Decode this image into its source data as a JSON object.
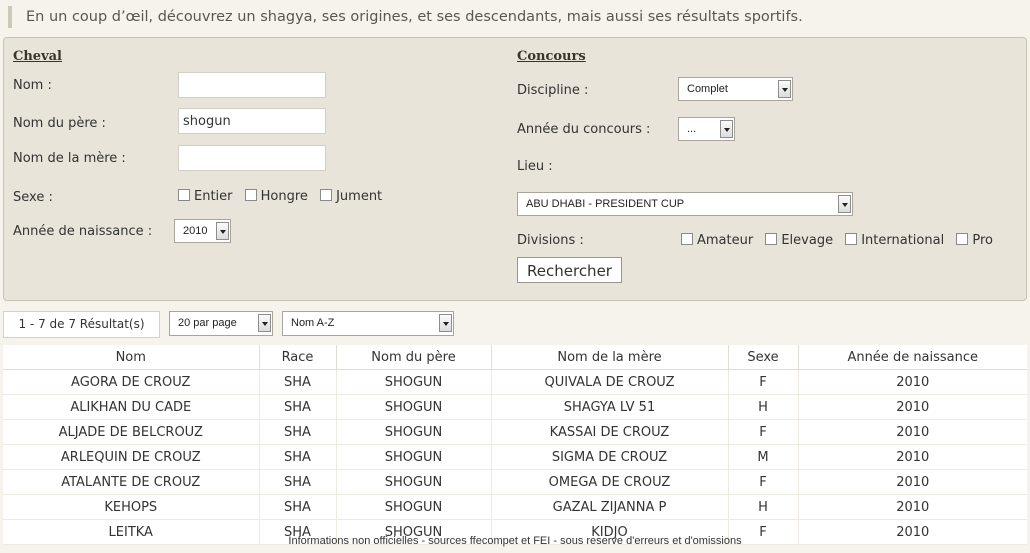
{
  "intro": "En un coup d’œil, découvrez un shagya, ses origines, et ses descendants, mais aussi ses résultats sportifs.",
  "cheval": {
    "title": "Cheval",
    "nom_label": "Nom :",
    "nom_value": "",
    "pere_label": "Nom du père :",
    "pere_value": "shogun",
    "mere_label": "Nom de la mère :",
    "mere_value": "",
    "sexe_label": "Sexe :",
    "sexe_options": [
      "Entier",
      "Hongre",
      "Jument"
    ],
    "annee_label": "Année de naissance :",
    "annee_value": "2010"
  },
  "concours": {
    "title": "Concours",
    "discipline_label": "Discipline :",
    "discipline_value": "Complet",
    "annee_label": "Année du concours :",
    "annee_value": "...",
    "lieu_label": "Lieu :",
    "lieu_value": "ABU DHABI - PRESIDENT CUP",
    "divisions_label": "Divisions :",
    "divisions_options": [
      "Amateur",
      "Elevage",
      "International",
      "Pro"
    ],
    "search_button": "Rechercher"
  },
  "results": {
    "count": "1 - 7 de 7 Résultat(s)",
    "per_page": "20 par page",
    "sort": "Nom A-Z"
  },
  "table": {
    "headers": [
      "Nom",
      "Race",
      "Nom du père",
      "Nom de la mère",
      "Sexe",
      "Année de naissance"
    ],
    "rows": [
      [
        "AGORA DE CROUZ",
        "SHA",
        "SHOGUN",
        "QUIVALA DE CROUZ",
        "F",
        "2010"
      ],
      [
        "ALIKHAN DU CADE",
        "SHA",
        "SHOGUN",
        "SHAGYA LV 51",
        "H",
        "2010"
      ],
      [
        "ALJADE DE BELCROUZ",
        "SHA",
        "SHOGUN",
        "KASSAI DE CROUZ",
        "F",
        "2010"
      ],
      [
        "ARLEQUIN DE CROUZ",
        "SHA",
        "SHOGUN",
        "SIGMA DE CROUZ",
        "M",
        "2010"
      ],
      [
        "ATALANTE DE CROUZ",
        "SHA",
        "SHOGUN",
        "OMEGA DE CROUZ",
        "F",
        "2010"
      ],
      [
        "KEHOPS",
        "SHA",
        "SHOGUN",
        "GAZAL ZIJANNA P",
        "H",
        "2010"
      ],
      [
        "LEITKA",
        "SHA",
        "SHOGUN",
        "KIDJO",
        "F",
        "2010"
      ]
    ]
  },
  "footer": "Informations non officielles - sources ffecompet et FEI - sous reserve d'erreurs et d'omissions"
}
